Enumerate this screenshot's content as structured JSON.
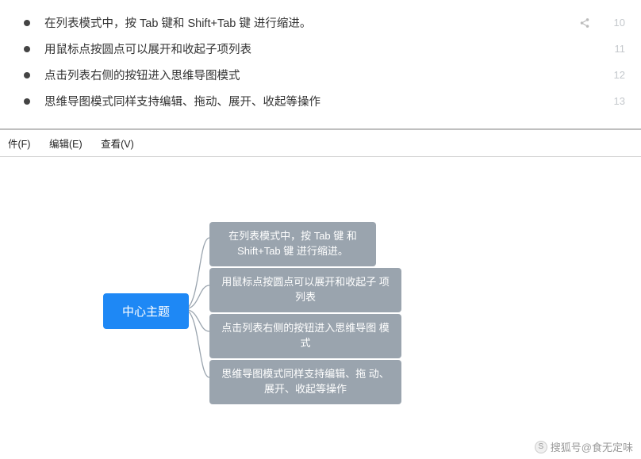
{
  "list": {
    "items": [
      {
        "text": "在列表模式中，按 Tab 键和 Shift+Tab 键 进行缩进。",
        "num": "10",
        "share": true
      },
      {
        "text": "用鼠标点按圆点可以展开和收起子项列表",
        "num": "11",
        "share": false
      },
      {
        "text": "点击列表右侧的按钮进入思维导图模式",
        "num": "12",
        "share": false
      },
      {
        "text": "思维导图模式同样支持编辑、拖动、展开、收起等操作",
        "num": "13",
        "share": false
      }
    ]
  },
  "menu": {
    "file": "件(F)",
    "edit": "编辑(E)",
    "view": "查看(V)"
  },
  "mindmap": {
    "center": "中心主题",
    "children": [
      "在列表模式中，按 Tab 键\n和 Shift+Tab 键 进行缩进。",
      "用鼠标点按圆点可以展开和收起子\n项列表",
      "点击列表右侧的按钮进入思维导图\n模式",
      "思维导图模式同样支持编辑、拖\n动、展开、收起等操作"
    ]
  },
  "watermark": "搜狐号@食无定味"
}
